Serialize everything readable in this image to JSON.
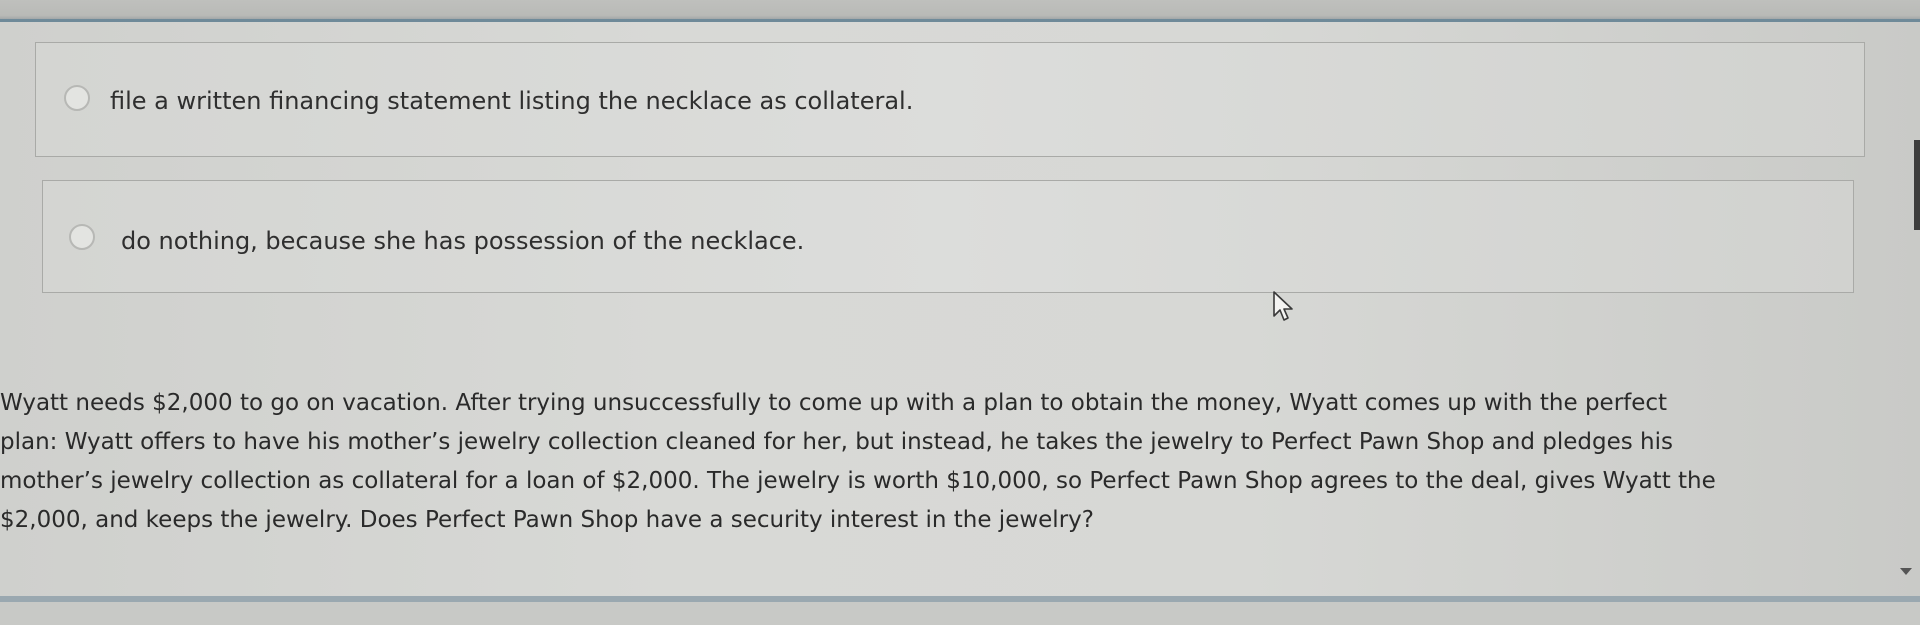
{
  "options": [
    {
      "label": "file a written financing statement listing the necklace as collateral.",
      "selected": false
    },
    {
      "label": "do nothing, because she has possession of the necklace.",
      "selected": false
    }
  ],
  "question": {
    "lines": [
      "Wyatt needs $2,000 to go on vacation. After trying unsuccessfully to come up with a plan to obtain the money, Wyatt comes up with the perfect",
      "plan: Wyatt offers to have his mother’s jewelry collection cleaned for her, but instead, he takes the jewelry to Perfect Pawn Shop and pledges his",
      "mother’s jewelry collection as collateral for a loan of $2,000. The jewelry is worth $10,000, so Perfect Pawn Shop agrees to the deal, gives Wyatt the",
      "$2,000, and keeps the jewelry. Does Perfect Pawn Shop have a security interest in the jewelry?"
    ]
  },
  "icons": {
    "cursor": "mouse-pointer-icon",
    "scroll": "chevron-down-icon"
  },
  "colors": {
    "accent_rule": "#6f8a99",
    "text": "#2b2b2b"
  }
}
